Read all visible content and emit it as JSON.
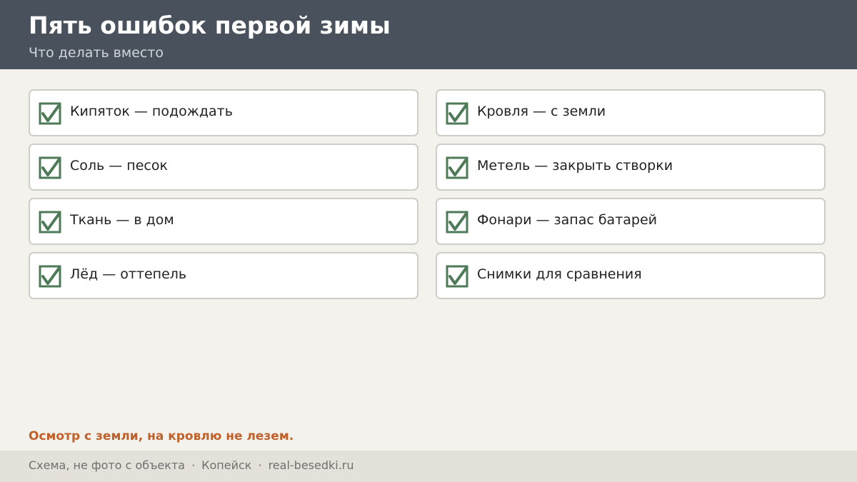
{
  "header": {
    "title": "Пять ошибок первой зимы",
    "subtitle": "Что делать вместо"
  },
  "items": [
    {
      "label": "Кипяток — подождать",
      "checked": true
    },
    {
      "label": "Кровля — с земли",
      "checked": true
    },
    {
      "label": "Соль — песок",
      "checked": true
    },
    {
      "label": "Метель — закрыть створки",
      "checked": true
    },
    {
      "label": "Ткань — в дом",
      "checked": true
    },
    {
      "label": "Фонари — запас батарей",
      "checked": true
    },
    {
      "label": "Лёд — оттепель",
      "checked": true
    },
    {
      "label": "Снимки для сравнения",
      "checked": true
    }
  ],
  "note": "Осмотр с земли, на кровлю не лезем.",
  "footer": {
    "parts": [
      "Схема, не фото с объекта",
      "Копейск",
      "real-besedki.ru"
    ],
    "separator": "·"
  },
  "colors": {
    "header_bg": "#48515c",
    "page_bg": "#f4f2ed",
    "check_green": "#4e7a57",
    "accent_orange": "#c0602a",
    "footer_bg": "#e4e1da"
  },
  "icons": {
    "check": "checkbox-checked-icon"
  }
}
